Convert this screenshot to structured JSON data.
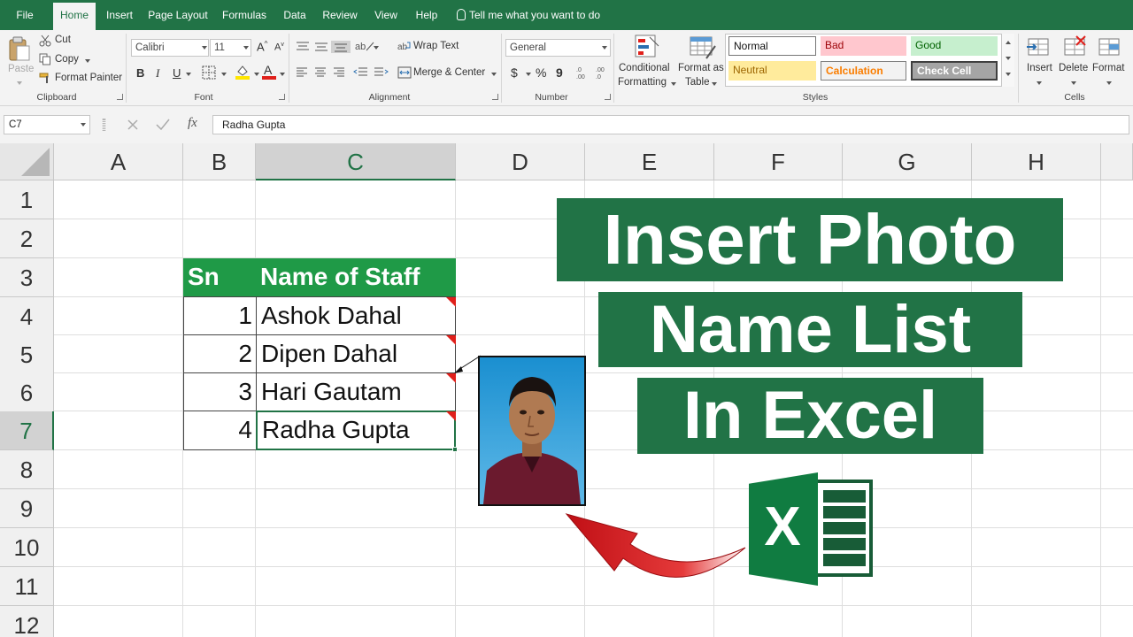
{
  "menu": {
    "file": "File",
    "home": "Home",
    "insert": "Insert",
    "page_layout": "Page Layout",
    "formulas": "Formulas",
    "data": "Data",
    "review": "Review",
    "view": "View",
    "help": "Help",
    "tell_me": "Tell me what you want to do"
  },
  "ribbon": {
    "clipboard": {
      "paste": "Paste",
      "cut": "Cut",
      "copy": "Copy",
      "format_painter": "Format Painter",
      "label": "Clipboard"
    },
    "font": {
      "name": "Calibri",
      "size": "11",
      "bold": "B",
      "italic": "I",
      "underline": "U",
      "label": "Font"
    },
    "alignment": {
      "wrap_text": "Wrap Text",
      "merge_center": "Merge & Center",
      "label": "Alignment"
    },
    "number": {
      "format": "General",
      "currency": "$",
      "percent": "%",
      "comma": "9",
      "label": "Number"
    },
    "styles": {
      "conditional": "Conditional",
      "formatting": "Formatting",
      "format_as": "Format as",
      "table": "Table",
      "normal": "Normal",
      "bad": "Bad",
      "good": "Good",
      "neutral": "Neutral",
      "calculation": "Calculation",
      "check_cell": "Check Cell",
      "label": "Styles"
    },
    "cells": {
      "insert": "Insert",
      "delete": "Delete",
      "format": "Format",
      "label": "Cells"
    }
  },
  "formula_bar": {
    "name_box": "C7",
    "fx": "fx",
    "value": "Radha Gupta"
  },
  "columns": [
    "A",
    "B",
    "C",
    "D",
    "E",
    "F",
    "G",
    "H"
  ],
  "rows": [
    "1",
    "2",
    "3",
    "4",
    "5",
    "6",
    "7",
    "8",
    "9",
    "10",
    "11",
    "12"
  ],
  "table": {
    "header": {
      "sn": "Sn",
      "name": "Name of Staff"
    },
    "rows": [
      {
        "sn": "1",
        "name": "Ashok Dahal"
      },
      {
        "sn": "2",
        "name": "Dipen Dahal"
      },
      {
        "sn": "3",
        "name": "Hari Gautam"
      },
      {
        "sn": "4",
        "name": "Radha Gupta"
      }
    ]
  },
  "title": {
    "line1": "Insert Photo",
    "line2": "Name List",
    "line3": "In Excel"
  },
  "logo_letter": "X",
  "colors": {
    "excel_green": "#217346",
    "header_green": "#1f9a47",
    "arrow_red": "#d0161b",
    "comment_red": "#e0201b"
  }
}
